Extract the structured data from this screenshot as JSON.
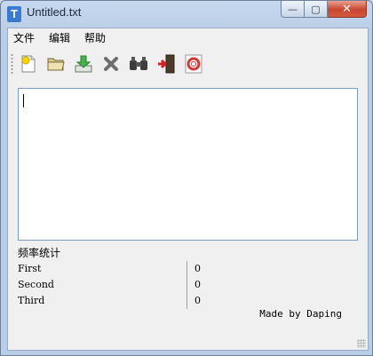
{
  "window": {
    "title": "Untitled.txt",
    "app_icon_glyph": "T",
    "buttons": {
      "minimize": "—",
      "maximize": "▢",
      "close": "✕"
    }
  },
  "menu": [
    "文件",
    "编辑",
    "帮助"
  ],
  "toolbar": {
    "buttons": [
      {
        "icon": "new-file-icon"
      },
      {
        "icon": "open-folder-icon"
      },
      {
        "icon": "save-download-icon"
      },
      {
        "icon": "delete-x-icon"
      },
      {
        "icon": "binoculars-find-icon"
      },
      {
        "icon": "exit-door-icon"
      },
      {
        "icon": "help-lifebuoy-icon"
      }
    ]
  },
  "editor": {
    "value": ""
  },
  "stats": {
    "title": "频率统计",
    "rows": [
      {
        "label": "First",
        "value": "0"
      },
      {
        "label": "Second",
        "value": "0"
      },
      {
        "label": "Third",
        "value": "0"
      }
    ]
  },
  "credit": "Made by Daping",
  "colors": {
    "titlebar": "#c6d8ee",
    "client": "#f0f0f0",
    "editor_border": "#7a9cc0",
    "close_button": "#c9462f"
  }
}
